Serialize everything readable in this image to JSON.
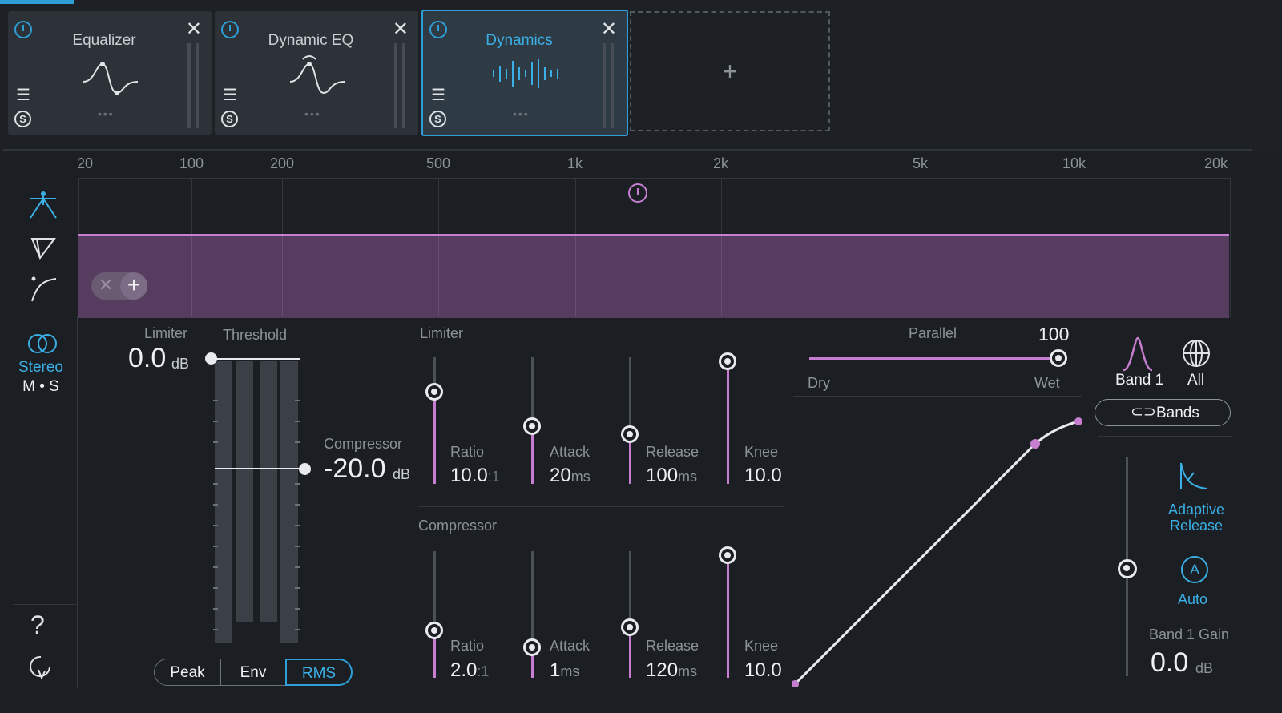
{
  "modules": [
    {
      "name": "Equalizer",
      "selected": false
    },
    {
      "name": "Dynamic EQ",
      "selected": false
    },
    {
      "name": "Dynamics",
      "selected": true
    }
  ],
  "add_module_symbol": "+",
  "frequency_labels": [
    "20",
    "100",
    "200",
    "500",
    "1k",
    "2k",
    "5k",
    "10k",
    "20k"
  ],
  "sidebar": {
    "stereo_label": "Stereo",
    "ms_label": "M • S",
    "help_symbol": "?"
  },
  "limiter_threshold": {
    "section_label": "Limiter",
    "value": "0.0",
    "unit": "dB"
  },
  "threshold_label": "Threshold",
  "compressor_threshold": {
    "section_label": "Compressor",
    "value": "-20.0",
    "unit": "dB"
  },
  "detection_modes": {
    "options": [
      "Peak",
      "Env",
      "RMS"
    ],
    "selected": "RMS"
  },
  "limiter": {
    "label": "Limiter",
    "ratio": {
      "label": "Ratio",
      "value": "10.0",
      "suffix": ":1",
      "level": 0.8
    },
    "attack": {
      "label": "Attack",
      "value": "20",
      "suffix": "ms",
      "level": 0.5
    },
    "release": {
      "label": "Release",
      "value": "100",
      "suffix": "ms",
      "level": 0.4
    },
    "knee": {
      "label": "Knee",
      "value": "10.0",
      "suffix": "",
      "level": 1.0
    }
  },
  "compressor": {
    "label": "Compressor",
    "ratio": {
      "label": "Ratio",
      "value": "2.0",
      "suffix": ":1",
      "level": 0.4
    },
    "attack": {
      "label": "Attack",
      "value": "1",
      "suffix": "ms",
      "level": 0.2
    },
    "release": {
      "label": "Release",
      "value": "120",
      "suffix": "ms",
      "level": 0.4
    },
    "knee": {
      "label": "Knee",
      "value": "10.0",
      "suffix": "",
      "level": 1.0
    }
  },
  "parallel": {
    "label": "Parallel",
    "value": "100",
    "dry_label": "Dry",
    "wet_label": "Wet"
  },
  "band_select": {
    "band_label": "Band 1",
    "all_label": "All",
    "bands_button": "Bands"
  },
  "adaptive_release": {
    "label_line1": "Adaptive",
    "label_line2": "Release"
  },
  "auto": {
    "icon_letter": "A",
    "label": "Auto"
  },
  "band_gain": {
    "label": "Band 1 Gain",
    "value": "0.0",
    "unit": "dB"
  },
  "colors": {
    "accent_blue": "#2e9fd6",
    "accent_purple": "#c77ed0",
    "band_fill": "#563c5e",
    "background": "#1b1f23"
  }
}
